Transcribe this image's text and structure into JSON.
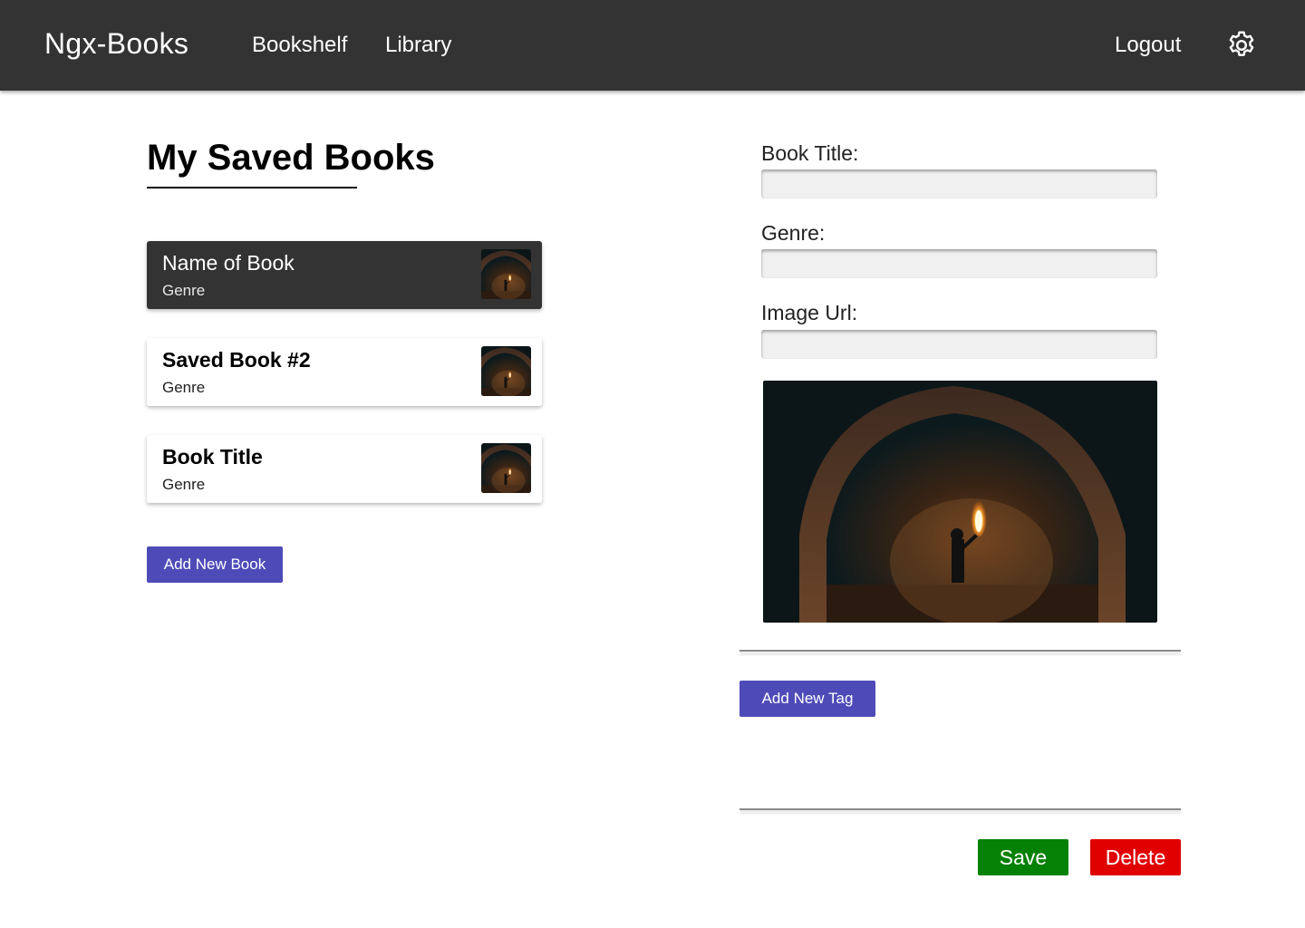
{
  "app": {
    "brand": "Ngx-Books",
    "nav": {
      "bookshelf": "Bookshelf",
      "library": "Library",
      "logout": "Logout"
    },
    "settings_icon": "gear-icon"
  },
  "main": {
    "title": "My Saved Books",
    "books": [
      {
        "name": "Name of Book",
        "genre": "Genre",
        "selected": true
      },
      {
        "name": "Saved Book #2",
        "genre": "Genre",
        "selected": false
      },
      {
        "name": "Book Title",
        "genre": "Genre",
        "selected": false
      }
    ],
    "add_book_label": "Add New Book"
  },
  "form": {
    "title_label": "Book Title:",
    "title_value": "",
    "genre_label": "Genre:",
    "genre_value": "",
    "image_label": "Image Url:",
    "image_value": "",
    "add_tag_label": "Add New Tag",
    "save_label": "Save",
    "delete_label": "Delete"
  },
  "colors": {
    "topbar": "#333333",
    "accent": "#4e4bb8",
    "save": "#058105",
    "delete": "#e00000"
  }
}
